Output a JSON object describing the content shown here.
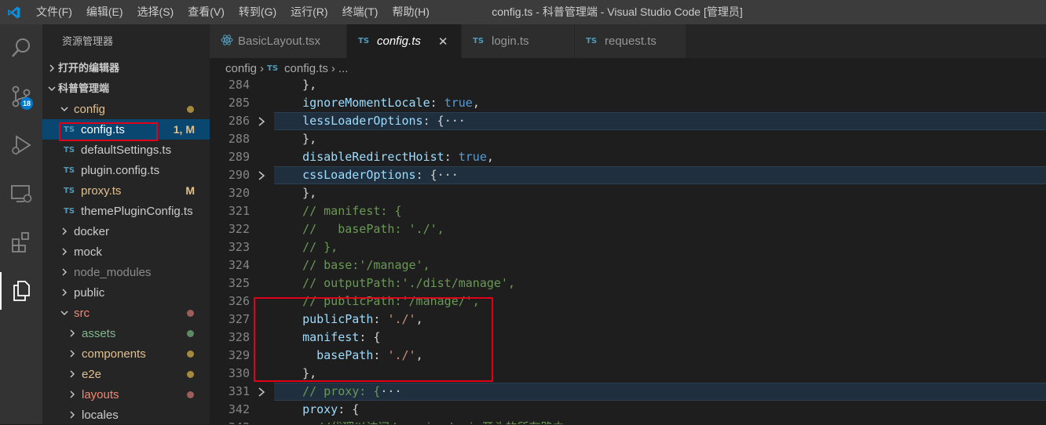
{
  "window": {
    "title": "config.ts - 科普管理端 - Visual Studio Code [管理员]",
    "menu": [
      "文件(F)",
      "编辑(E)",
      "选择(S)",
      "查看(V)",
      "转到(G)",
      "运行(R)",
      "终端(T)",
      "帮助(H)"
    ]
  },
  "activity_bar": {
    "items": [
      "search-icon",
      "source-control-icon",
      "run-debug-icon",
      "remote-explorer-icon",
      "extensions-icon",
      "explorer-icon"
    ],
    "source_control_badge": "18"
  },
  "sidebar": {
    "title": "资源管理器",
    "open_editors_label": "打开的编辑器",
    "project_label": "科普管理端",
    "tree": [
      {
        "label": "config",
        "kind": "folder",
        "expanded": true,
        "color": "#e2c08d",
        "dot": "#a58a3e"
      },
      {
        "label": "config.ts",
        "kind": "ts",
        "color": "#ffffff",
        "status": "1, M",
        "status_color": "#e2c08d",
        "selected": true
      },
      {
        "label": "defaultSettings.ts",
        "kind": "ts",
        "color": "#cccccc"
      },
      {
        "label": "plugin.config.ts",
        "kind": "ts",
        "color": "#cccccc"
      },
      {
        "label": "proxy.ts",
        "kind": "ts",
        "color": "#e2c08d",
        "status": "M",
        "status_color": "#e2c08d"
      },
      {
        "label": "themePluginConfig.ts",
        "kind": "ts",
        "color": "#cccccc"
      },
      {
        "label": "docker",
        "kind": "folder",
        "expanded": false,
        "color": "#cccccc"
      },
      {
        "label": "mock",
        "kind": "folder",
        "expanded": false,
        "color": "#cccccc"
      },
      {
        "label": "node_modules",
        "kind": "folder",
        "expanded": false,
        "color": "#8c8c8c"
      },
      {
        "label": "public",
        "kind": "folder",
        "expanded": false,
        "color": "#cccccc"
      },
      {
        "label": "src",
        "kind": "folder",
        "expanded": true,
        "color": "#f48771",
        "dot": "#9d5d58"
      },
      {
        "label": "assets",
        "kind": "folder",
        "expanded": false,
        "color": "#81b88b",
        "dot": "#5e8a63",
        "indent": 1
      },
      {
        "label": "components",
        "kind": "folder",
        "expanded": false,
        "color": "#e2c08d",
        "dot": "#a58a3e",
        "indent": 1
      },
      {
        "label": "e2e",
        "kind": "folder",
        "expanded": false,
        "color": "#e2c08d",
        "dot": "#a58a3e",
        "indent": 1
      },
      {
        "label": "layouts",
        "kind": "folder",
        "expanded": false,
        "color": "#f48771",
        "dot": "#9d5d58",
        "indent": 1
      },
      {
        "label": "locales",
        "kind": "folder",
        "expanded": false,
        "color": "#cccccc",
        "indent": 1
      }
    ]
  },
  "tabs": [
    {
      "label": "BasicLayout.tsx",
      "kind": "tsx",
      "active": false
    },
    {
      "label": "config.ts",
      "kind": "ts",
      "active": true,
      "close": "✕"
    },
    {
      "label": "login.ts",
      "kind": "ts",
      "active": false
    },
    {
      "label": "request.ts",
      "kind": "ts",
      "active": false
    }
  ],
  "ts_label": "TS",
  "breadcrumb": {
    "folder": "config",
    "file": "config.ts",
    "rest": "..."
  },
  "code_lines": [
    {
      "n": "284",
      "t": [
        [
          "  },",
          ""
        ]
      ]
    },
    {
      "n": "285",
      "t": [
        [
          "  ",
          ""
        ],
        [
          "ignoreMomentLocale",
          "k"
        ],
        [
          ": ",
          ""
        ],
        [
          "true",
          "b"
        ],
        [
          ",",
          ""
        ]
      ]
    },
    {
      "n": "286",
      "fold": true,
      "hl": true,
      "t": [
        [
          "  ",
          ""
        ],
        [
          "lessLoaderOptions",
          "k"
        ],
        [
          ": {",
          ""
        ],
        [
          "···",
          "ell"
        ]
      ]
    },
    {
      "n": "288",
      "t": [
        [
          "  },",
          ""
        ]
      ]
    },
    {
      "n": "289",
      "t": [
        [
          "  ",
          ""
        ],
        [
          "disableRedirectHoist",
          "k"
        ],
        [
          ": ",
          ""
        ],
        [
          "true",
          "b"
        ],
        [
          ",",
          ""
        ]
      ]
    },
    {
      "n": "290",
      "fold": true,
      "hl": true,
      "t": [
        [
          "  ",
          ""
        ],
        [
          "cssLoaderOptions",
          "k"
        ],
        [
          ": {",
          ""
        ],
        [
          "···",
          "ell"
        ]
      ]
    },
    {
      "n": "320",
      "t": [
        [
          "  },",
          ""
        ]
      ]
    },
    {
      "n": "321",
      "t": [
        [
          "  // manifest: {",
          "c"
        ]
      ]
    },
    {
      "n": "322",
      "t": [
        [
          "  //   basePath: './',",
          "c"
        ]
      ]
    },
    {
      "n": "323",
      "t": [
        [
          "  // },",
          "c"
        ]
      ]
    },
    {
      "n": "324",
      "t": [
        [
          "  // base:'/manage',",
          "c"
        ]
      ]
    },
    {
      "n": "325",
      "t": [
        [
          "  // outputPath:'./dist/manage',",
          "c"
        ]
      ]
    },
    {
      "n": "326",
      "t": [
        [
          "  // publicPath:'/manage/',",
          "c"
        ]
      ]
    },
    {
      "n": "327",
      "t": [
        [
          "  ",
          ""
        ],
        [
          "publicPath",
          "k"
        ],
        [
          ": ",
          ""
        ],
        [
          "'./'",
          "s"
        ],
        [
          ",",
          ""
        ]
      ]
    },
    {
      "n": "328",
      "t": [
        [
          "  ",
          ""
        ],
        [
          "manifest",
          "k"
        ],
        [
          ": {",
          ""
        ]
      ]
    },
    {
      "n": "329",
      "t": [
        [
          "    ",
          ""
        ],
        [
          "basePath",
          "k"
        ],
        [
          ": ",
          ""
        ],
        [
          "'./'",
          "s"
        ],
        [
          ",",
          ""
        ]
      ]
    },
    {
      "n": "330",
      "t": [
        [
          "  },",
          ""
        ]
      ]
    },
    {
      "n": "331",
      "fold": true,
      "hl": true,
      "t": [
        [
          "  // proxy: {",
          "c"
        ],
        [
          "···",
          "ell"
        ]
      ]
    },
    {
      "n": "342",
      "t": [
        [
          "  ",
          ""
        ],
        [
          "proxy",
          "k"
        ],
        [
          ": {",
          ""
        ]
      ]
    },
    {
      "n": "343",
      "t": [
        [
          "    //代理以访问/service/api 开头的所有路由",
          "c"
        ]
      ]
    }
  ],
  "colors": {
    "accent": "#007acc",
    "annotation_red": "#e0001a",
    "ts_blue": "#519aba"
  }
}
